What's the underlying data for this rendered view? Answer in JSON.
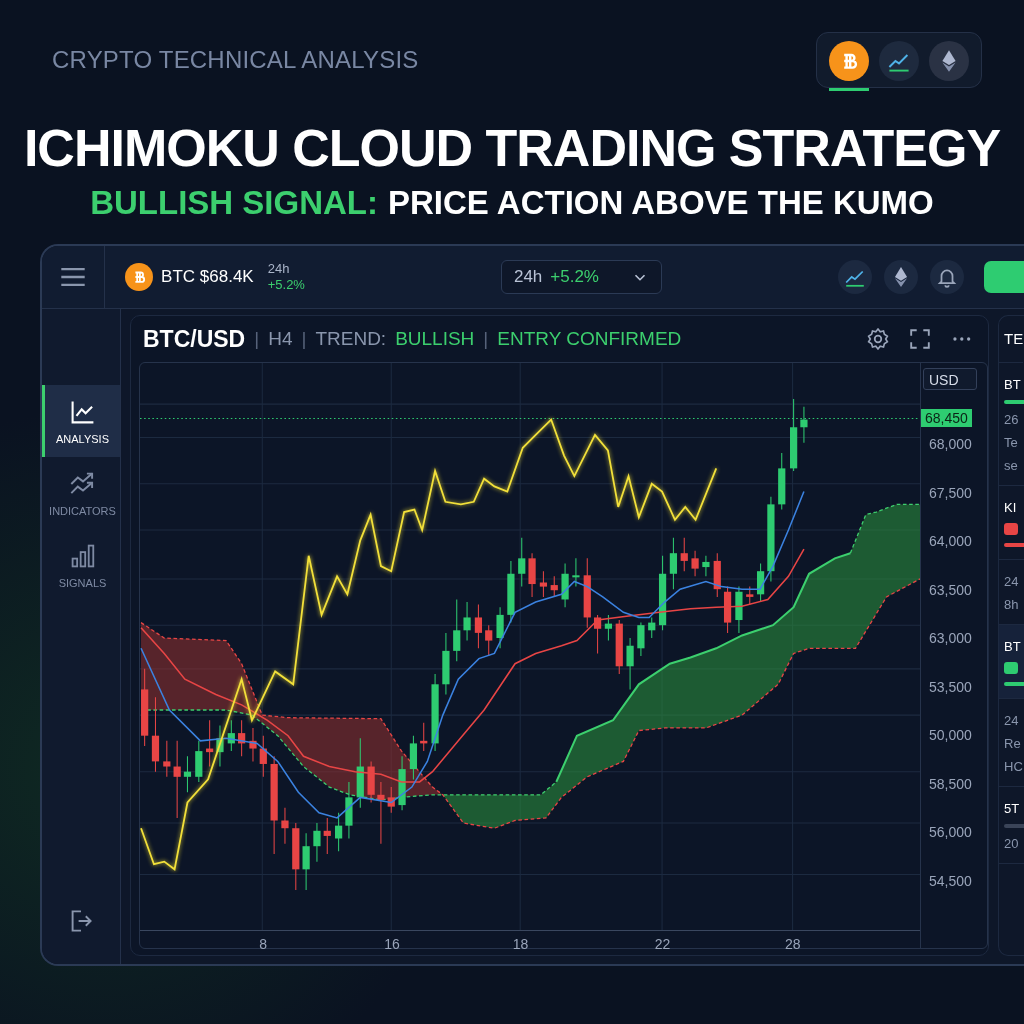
{
  "header": {
    "subtitle": "CRYPTO TECHNICAL ANALYSIS",
    "coins": [
      {
        "kind": "bitcoin",
        "selected": true
      },
      {
        "kind": "trend",
        "selected": false
      },
      {
        "kind": "ethereum",
        "selected": false
      }
    ],
    "title": "ICHIMOKU CLOUD TRADING STRATEGY",
    "headline": [
      {
        "text": "BULLISH SIGNAL:",
        "kind": "positive"
      },
      {
        "text": "PRICE ACTION ABOVE THE KUMO",
        "kind": "plain"
      }
    ]
  },
  "sidebar": {
    "items": [
      {
        "label": "ANALYSIS",
        "kind": "chart",
        "selected": true
      },
      {
        "label": "INDICATORS",
        "kind": "trends",
        "selected": false
      },
      {
        "label": "SIGNALS",
        "kind": "bars",
        "selected": false
      }
    ]
  },
  "topbar": {
    "ticker": "BTC $68.4K",
    "change_period": "24h",
    "change": "+5.2%",
    "dropdown": {
      "period": "24h",
      "change": "+5.2%"
    },
    "tools": [
      {
        "kind": "trend"
      },
      {
        "kind": "ethereum"
      },
      {
        "kind": "bell"
      }
    ]
  },
  "chart_panel": {
    "title_parts": [
      {
        "text": "BTC/USD",
        "kind": "title"
      },
      {
        "text": "|",
        "kind": "divider"
      },
      {
        "text": "H4",
        "kind": "muted"
      },
      {
        "text": "|",
        "kind": "divider"
      },
      {
        "text": "TREND:",
        "kind": "muted"
      },
      {
        "text": "BULLISH",
        "kind": "positive"
      },
      {
        "text": "|",
        "kind": "divider"
      },
      {
        "text": "ENTRY CONFIRMED",
        "kind": "positive"
      }
    ],
    "currency": "USD",
    "last_price": "68,450",
    "price_ticks": [
      "68,000",
      "67,500",
      "64,000",
      "63,500",
      "63,000",
      "53,500",
      "50,000",
      "58,500",
      "56,000",
      "54,500"
    ],
    "time_ticks": [
      "8",
      "16",
      "18",
      "22",
      "28"
    ]
  },
  "side_panel": {
    "title": "TE",
    "items": [
      {
        "title": "BT",
        "bar": {
          "color": "#2ecc71"
        },
        "lines": [
          "26",
          "Te",
          "se"
        ],
        "selected": false
      },
      {
        "title": "KI",
        "tag": {
          "color": "#e84545"
        },
        "bar": {
          "color": "#e84545"
        },
        "selected": false
      },
      {
        "lines": [
          "24",
          "8h"
        ],
        "selected": false
      },
      {
        "title": "BT",
        "tag": {
          "color": "#2ecc71"
        },
        "bar": {
          "color": "#2ecc71"
        },
        "selected": true
      },
      {
        "lines": [
          "24",
          "Re",
          "HC"
        ],
        "selected": false
      },
      {
        "title": "5T",
        "bar": {
          "color": "#3a4458"
        },
        "lines": [
          "20"
        ],
        "selected": false
      }
    ]
  }
}
